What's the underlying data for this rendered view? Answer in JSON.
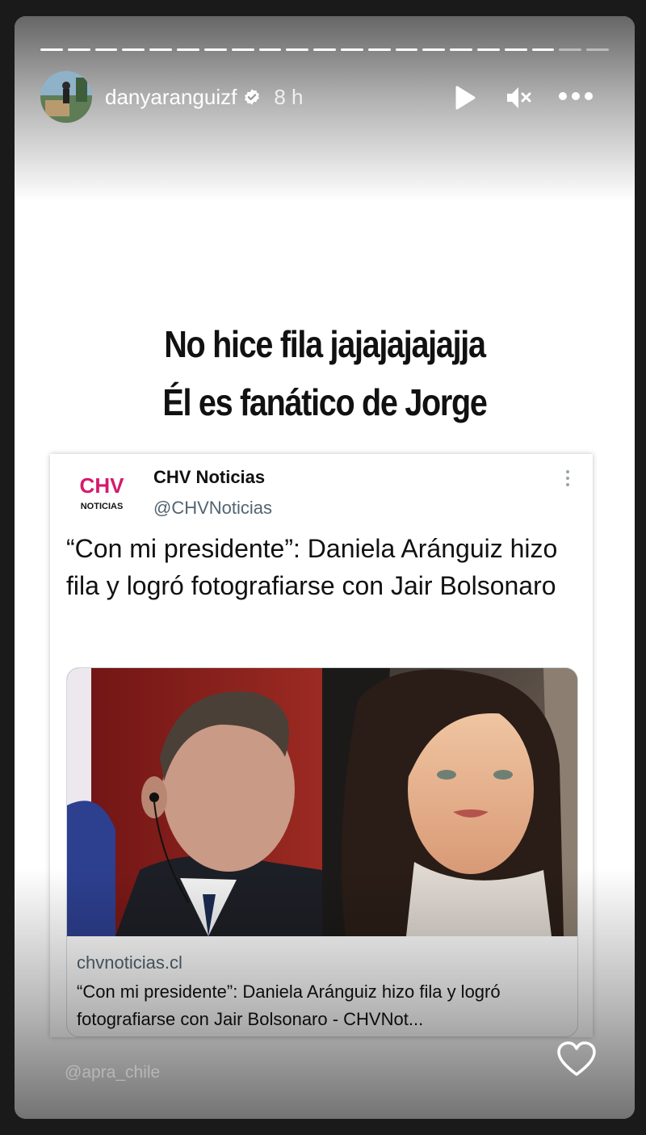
{
  "story": {
    "username": "danyaranguizf",
    "time": "8 h",
    "progress": {
      "segments": 21,
      "completed": 19
    },
    "caption_lines": [
      "No hice fila  jajajajajajja",
      "Él es fanático de Jorge"
    ],
    "watermark": "@apra_chile",
    "icons": [
      "play-icon",
      "mute-icon",
      "more-icon",
      "verified-icon",
      "heart-icon"
    ]
  },
  "tweet": {
    "logo_text": "CHV",
    "logo_sub": "NOTICIAS",
    "account_name": "CHV Noticias",
    "handle": "@CHVNoticias",
    "text": "“Con mi presidente”: Daniela Aránguiz hizo fila y logró fotografiarse con Jair Bolsonaro",
    "link": {
      "domain": "chvnoticias.cl",
      "title": "“Con mi presidente”: Daniela Aránguiz hizo fila y logró fotografiarse con Jair Bolsonaro - CHVNot..."
    }
  },
  "colors": {
    "brand_pink": "#d6196c",
    "secondary_text": "#536471"
  }
}
